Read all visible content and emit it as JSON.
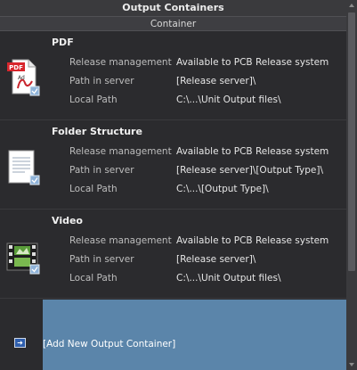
{
  "panel": {
    "title": "Output Containers",
    "column_header": "Container"
  },
  "containers": [
    {
      "name": "PDF",
      "icon": "pdf-document-icon",
      "properties": [
        {
          "label": "Release management",
          "value": "Available to PCB Release system"
        },
        {
          "label": "Path in server",
          "value": "[Release server]\\"
        },
        {
          "label": "Local Path",
          "value": "C:\\...\\Unit Output files\\"
        }
      ]
    },
    {
      "name": "Folder Structure",
      "icon": "folder-structure-document-icon",
      "properties": [
        {
          "label": "Release management",
          "value": "Available to PCB Release system"
        },
        {
          "label": "Path in server",
          "value": "[Release server]\\[Output Type]\\"
        },
        {
          "label": "Local Path",
          "value": "C:\\...\\[Output Type]\\"
        }
      ]
    },
    {
      "name": "Video",
      "icon": "video-film-icon",
      "properties": [
        {
          "label": "Release management",
          "value": "Available to PCB Release system"
        },
        {
          "label": "Path in server",
          "value": "[Release server]\\"
        },
        {
          "label": "Local Path",
          "value": "C:\\...\\Unit Output files\\"
        }
      ]
    }
  ],
  "add_new": {
    "label": "[Add New Output Container]",
    "icon": "add-arrow-icon"
  },
  "colors": {
    "background": "#2b2b2e",
    "selection": "#5b85aa",
    "header": "#3a3a3d"
  }
}
